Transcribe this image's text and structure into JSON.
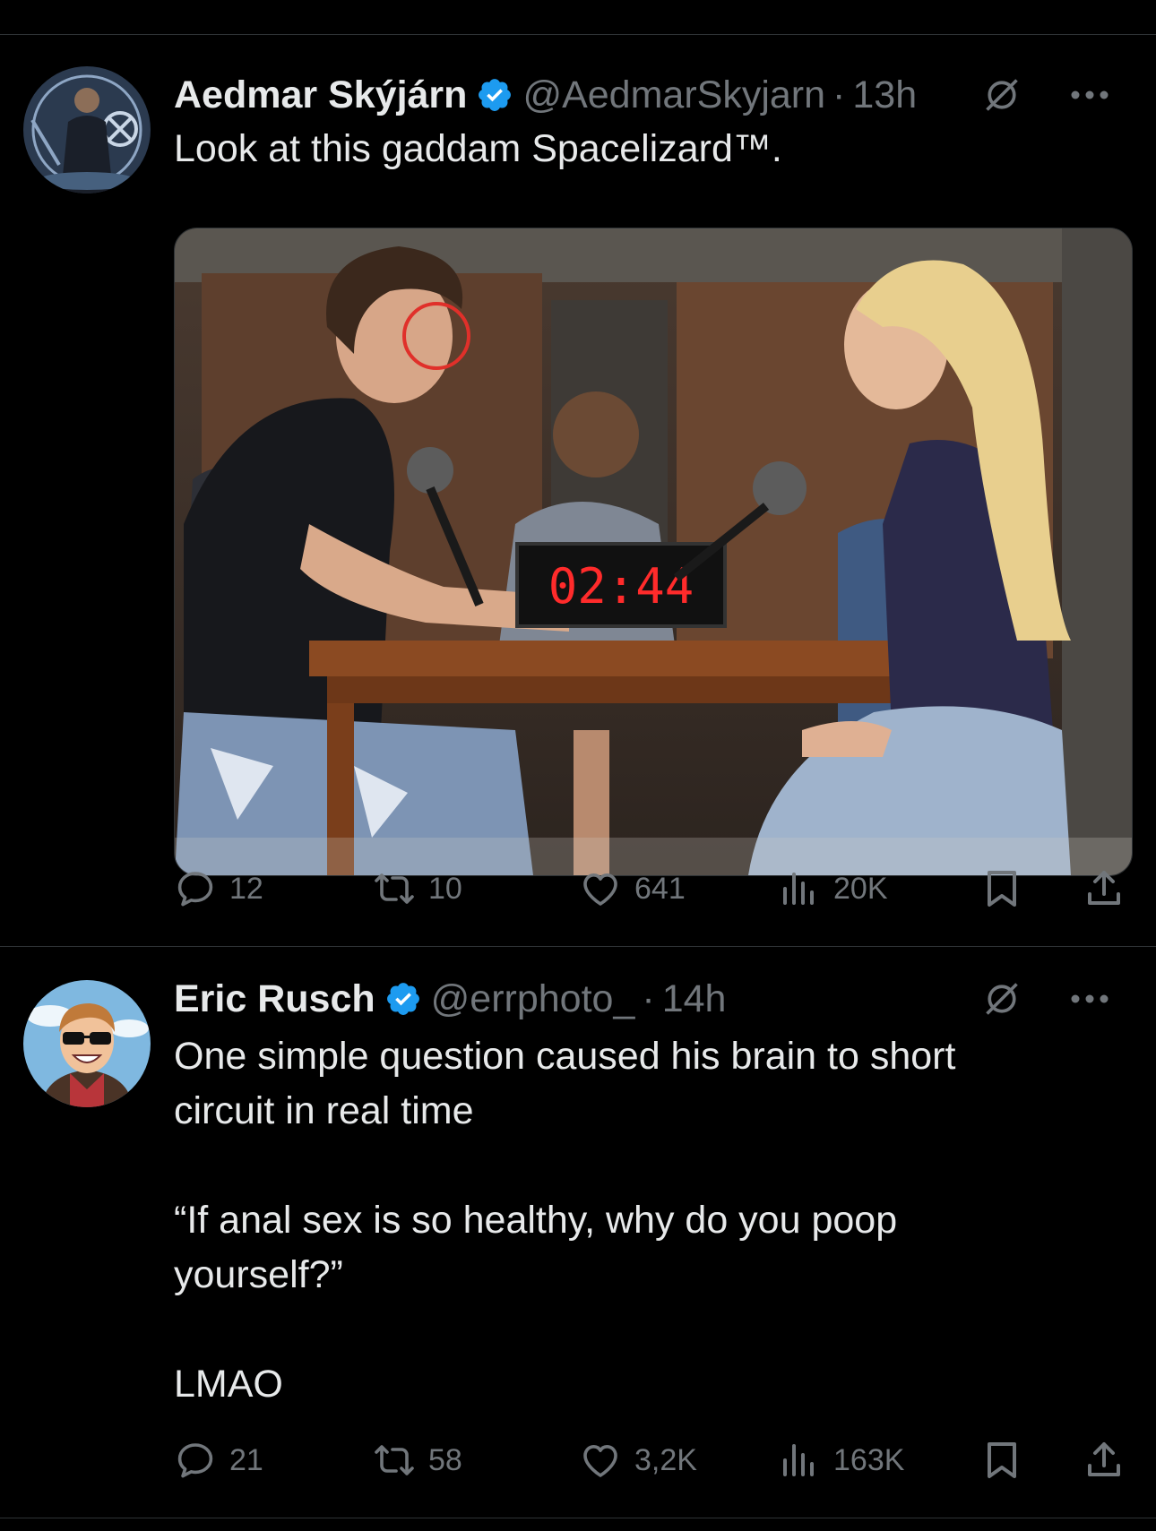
{
  "tweets": [
    {
      "name": "Aedmar Skýjárn",
      "handle": "@AedmarSkyjarn",
      "separator": "·",
      "time": "13h",
      "text": "Look at this gaddam Spacelizard™.",
      "media": {
        "clock_text": "02:44"
      },
      "stats": {
        "replies": "12",
        "reposts": "10",
        "likes": "641",
        "views": "20K"
      }
    },
    {
      "name": "Eric Rusch",
      "handle": "@errphoto_",
      "separator": "·",
      "time": "14h",
      "text_lines": [
        "One simple question caused his brain to short",
        "circuit in real time",
        "",
        "“If anal sex is so healthy, why do you poop",
        "yourself?”",
        "",
        "LMAO"
      ],
      "stats": {
        "replies": "21",
        "reposts": "58",
        "likes": "3,2K",
        "views": "163K"
      }
    }
  ],
  "colors": {
    "background": "#000000",
    "text": "#e7e9ea",
    "muted": "#71767b",
    "verified": "#1d9bf0",
    "divider": "#2f3336"
  },
  "icons": [
    "verified-badge-icon",
    "grok-icon",
    "more-icon",
    "reply-icon",
    "repost-icon",
    "like-icon",
    "views-icon",
    "bookmark-icon",
    "share-icon"
  ]
}
